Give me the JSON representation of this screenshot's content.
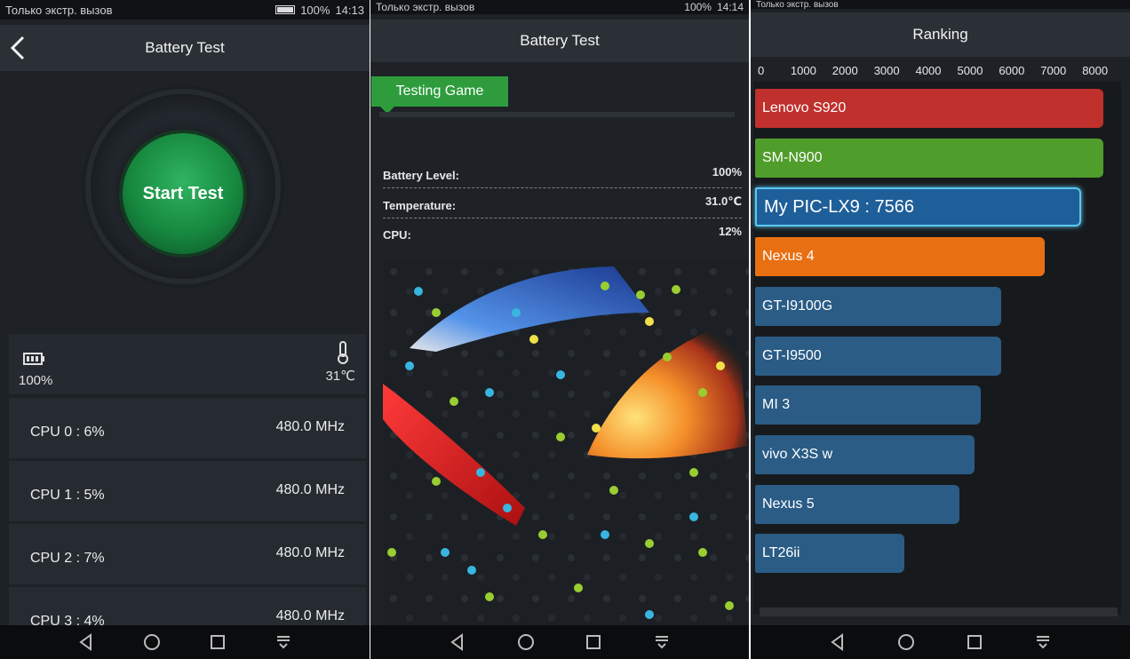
{
  "status": {
    "carrier_text": "Только экстр. вызов",
    "battery_pct": "100%",
    "time_p1": "14:13",
    "time_p2": "14:14"
  },
  "panel1": {
    "title": "Battery Test",
    "start_label": "Start Test",
    "battery_level": "100%",
    "temperature": "31℃",
    "cpus": [
      {
        "label": "CPU  0 : 6%",
        "freq": "480.0 MHz"
      },
      {
        "label": "CPU  1 : 5%",
        "freq": "480.0 MHz"
      },
      {
        "label": "CPU  2 : 7%",
        "freq": "480.0 MHz"
      },
      {
        "label": "CPU  3 : 4%",
        "freq": "480.0 MHz"
      }
    ]
  },
  "panel2": {
    "title": "Battery Test",
    "testing_label": "Testing Game",
    "stats": [
      {
        "label": "Battery Level:",
        "value": "100%"
      },
      {
        "label": "Temperature:",
        "value": "31.0℃"
      },
      {
        "label": "CPU:",
        "value": "12%"
      }
    ]
  },
  "panel3": {
    "title": "Ranking",
    "axis_ticks": [
      "0",
      "1000",
      "2000",
      "3000",
      "4000",
      "5000",
      "6000",
      "7000",
      "8000"
    ],
    "bars": [
      {
        "label": "Lenovo S920",
        "value": 8200,
        "color": "#c0302c"
      },
      {
        "label": "SM-N900",
        "value": 8200,
        "color": "#4f9d2a"
      },
      {
        "label": "My PIC-LX9 :  7566",
        "value": 7566,
        "color": "#1f5f99",
        "highlight": true
      },
      {
        "label": "Nexus 4",
        "value": 6700,
        "color": "#e86f12"
      },
      {
        "label": "GT-I9100G",
        "value": 5650,
        "color": "#2a5c86"
      },
      {
        "label": "GT-I9500",
        "value": 5650,
        "color": "#2a5c86"
      },
      {
        "label": "MI 3",
        "value": 5150,
        "color": "#2a5c86"
      },
      {
        "label": "vivo X3S w",
        "value": 5000,
        "color": "#2a5c86"
      },
      {
        "label": "Nexus 5",
        "value": 4650,
        "color": "#2a5c86"
      },
      {
        "label": "LT26ii",
        "value": 3320,
        "color": "#2a5c86"
      }
    ]
  },
  "icons": {
    "back": "back-arrow-icon",
    "battery": "battery-icon",
    "thermometer": "thermometer-icon",
    "nav": [
      "nav-back-icon",
      "nav-home-icon",
      "nav-recents-icon",
      "nav-notifications-icon"
    ]
  }
}
